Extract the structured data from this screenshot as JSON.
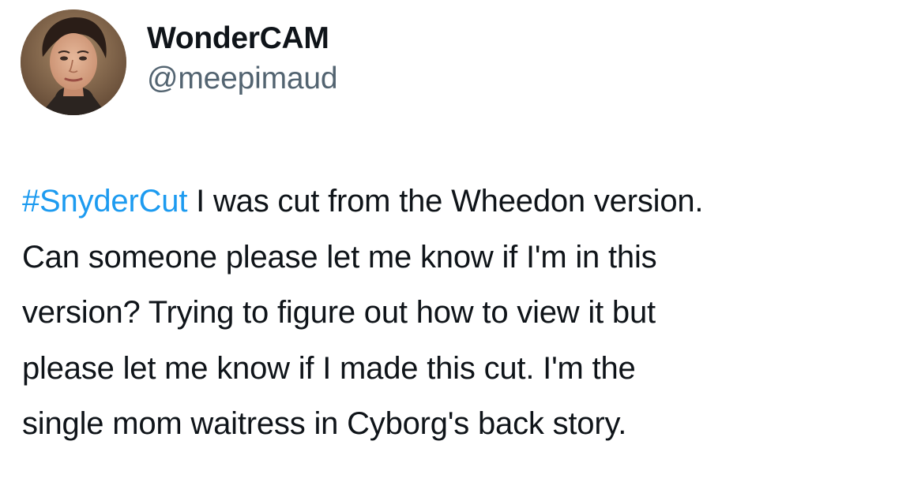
{
  "author": {
    "display_name": "WonderCAM",
    "handle": "@meepimaud",
    "avatar_icon": "profile-photo-icon"
  },
  "tweet": {
    "hashtag": "#SnyderCut",
    "lines": [
      " I was cut from the Wheedon version.",
      "Can someone please let me know if I'm in this",
      "version? Trying to figure out how to view it but",
      "please let me know if I made this cut.  I'm the",
      "single mom waitress in Cyborg's back story."
    ]
  },
  "colors": {
    "hashtag": "#1d9bf0",
    "text": "#0f1419",
    "secondary_text": "#536471",
    "background": "#ffffff"
  }
}
